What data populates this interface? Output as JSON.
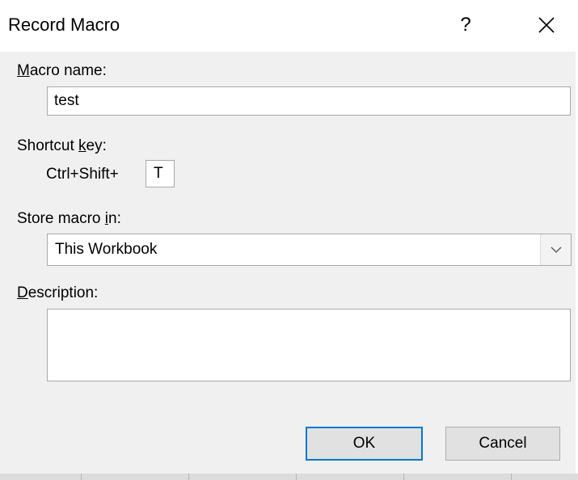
{
  "dialog": {
    "title": "Record Macro",
    "help_label": "?",
    "macro_name": {
      "label_mnemonic": "M",
      "label_rest": "acro name:",
      "value": "test"
    },
    "shortcut": {
      "label_prefix": "Shortcut ",
      "label_mnemonic": "k",
      "label_suffix": "ey:",
      "modifier_text": "Ctrl+Shift+",
      "key_value": "T"
    },
    "store": {
      "label_prefix": "Store macro ",
      "label_mnemonic": "i",
      "label_suffix": "n:",
      "selected": "This Workbook"
    },
    "description": {
      "label_mnemonic": "D",
      "label_rest": "escription:",
      "value": ""
    },
    "buttons": {
      "ok": "OK",
      "cancel": "Cancel"
    }
  },
  "icons": {
    "close": "close-icon",
    "dropdown": "chevron-down-icon"
  },
  "colors": {
    "default_button_border": "#0078d7",
    "dialog_background": "#f0f0f0"
  }
}
